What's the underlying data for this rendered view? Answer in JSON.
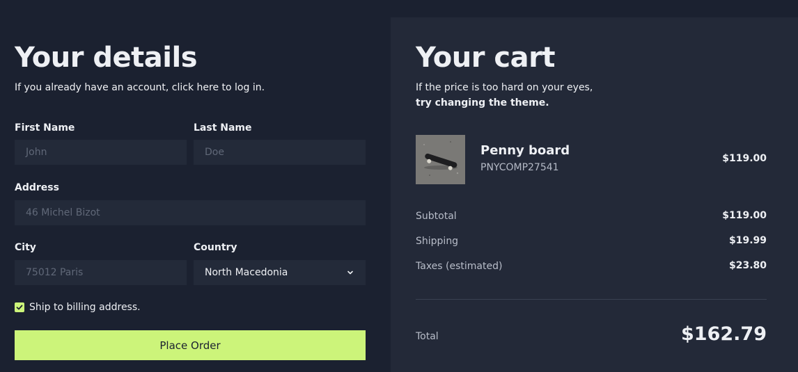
{
  "details": {
    "title": "Your details",
    "subtitle": "If you already have an account, click here to log in.",
    "first_name": {
      "label": "First Name",
      "placeholder": "John"
    },
    "last_name": {
      "label": "Last Name",
      "placeholder": "Doe"
    },
    "address": {
      "label": "Address",
      "placeholder": "46 Michel Bizot"
    },
    "city": {
      "label": "City",
      "placeholder": "75012 Paris"
    },
    "country": {
      "label": "Country",
      "value": "North Macedonia",
      "icon": "chevron-down-icon"
    },
    "ship_checkbox": {
      "label": "Ship to billing address.",
      "checked": true,
      "icon": "checkmark-icon"
    },
    "place_order": "Place Order"
  },
  "cart": {
    "title": "Your cart",
    "subtitle_line1": "If the price is too hard on your eyes,",
    "subtitle_line2": "try changing the theme.",
    "item": {
      "name": "Penny board",
      "sku": "PNYCOMP27541",
      "price": "$119.00",
      "image": "skateboard-image"
    },
    "subtotal": {
      "label": "Subtotal",
      "value": "$119.00"
    },
    "shipping": {
      "label": "Shipping",
      "value": "$19.99"
    },
    "taxes": {
      "label": "Taxes (estimated)",
      "value": "$23.80"
    },
    "total": {
      "label": "Total",
      "value": "$162.79"
    }
  },
  "colors": {
    "background": "#1b2130",
    "panel": "#232938",
    "input": "#232a39",
    "accent": "#ccf47a"
  }
}
